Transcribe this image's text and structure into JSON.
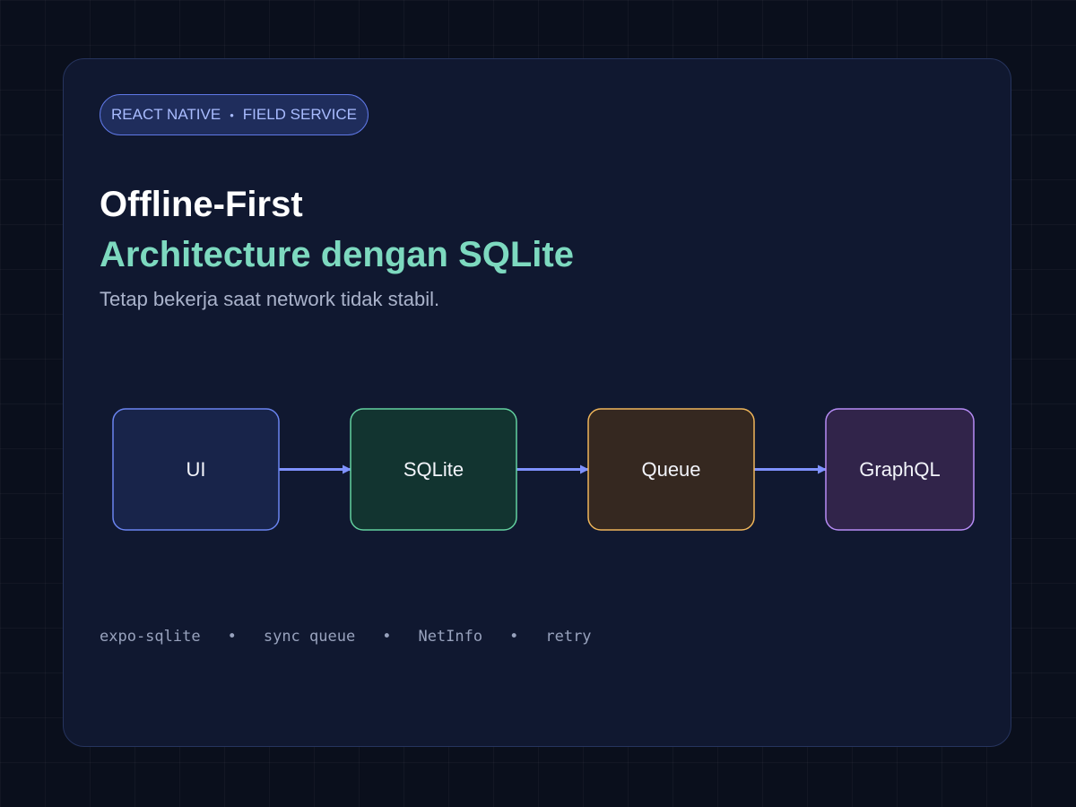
{
  "tag": {
    "left": "REACT NATIVE",
    "separator": "•",
    "right": "FIELD SERVICE"
  },
  "title": "Offline-First",
  "subtitle": "Architecture dengan SQLite",
  "description": "Tetap bekerja saat network tidak stabil.",
  "flow": {
    "nodes": [
      {
        "label": "UI",
        "color": "#6a84f0",
        "fill": "#18244a"
      },
      {
        "label": "SQLite",
        "color": "#63d1a0",
        "fill": "#123430"
      },
      {
        "label": "Queue",
        "color": "#f0b65a",
        "fill": "#352820"
      },
      {
        "label": "GraphQL",
        "color": "#b78cf6",
        "fill": "#31244a"
      }
    ],
    "arrow_color": "#7f92ff"
  },
  "tech": {
    "items": [
      "expo-sqlite",
      "sync queue",
      "NetInfo",
      "retry"
    ],
    "separator": "•"
  },
  "colors": {
    "background": "#0a0f1c",
    "card": "#101830",
    "accent_green": "#7dd9bf",
    "accent_blue": "#a9bcff"
  }
}
